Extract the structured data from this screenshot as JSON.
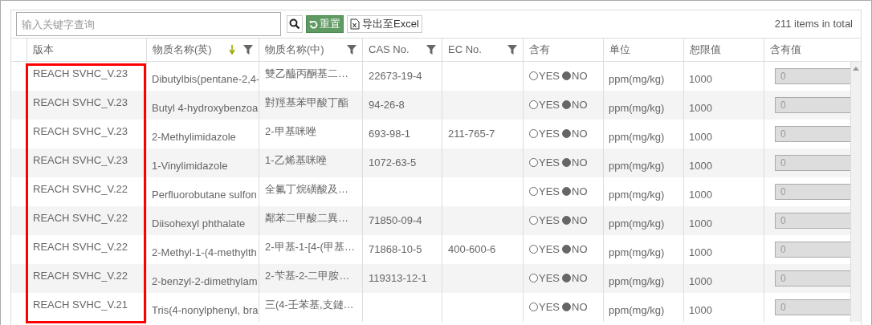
{
  "toolbar": {
    "search": {
      "placeholder": "输入关键字查询"
    },
    "reset_button": "重置",
    "export_button": "导出至Excel",
    "total": "211 items in total"
  },
  "columns": [
    {
      "label": "版本",
      "filter": false,
      "highlighted": true
    },
    {
      "label": "物质名称(英)",
      "filter": true,
      "sorted_descending": true
    },
    {
      "label": "物质名称(中)",
      "filter": true
    },
    {
      "label": "CAS No.",
      "filter": true
    },
    {
      "label": "EC No.",
      "filter": true
    },
    {
      "label": "含有",
      "filter": false
    },
    {
      "label": "单位",
      "filter": false
    },
    {
      "label": "恕限值",
      "filter": false
    },
    {
      "label": "含有值",
      "filter": false
    }
  ],
  "rows": [
    {
      "version": "REACH SVHC_V.23",
      "name_en": "Dibutylbis(pentane-2,4-",
      "name_zh": "雙乙醯丙酮基二…",
      "cas": "22673-19-4",
      "ec": "",
      "options": [
        {
          "label": "YES",
          "selected": false
        },
        {
          "label": "NO",
          "selected": true
        }
      ],
      "unit": "ppm(mg/kg)",
      "threshold": "1000",
      "value": "0"
    },
    {
      "version": "REACH SVHC_V.23",
      "name_en": "Butyl 4-hydroxybenzoa",
      "name_zh": "對羥基苯甲酸丁酯",
      "cas": "94-26-8",
      "ec": "",
      "options": [
        {
          "label": "YES",
          "selected": false
        },
        {
          "label": "NO",
          "selected": true
        }
      ],
      "unit": "ppm(mg/kg)",
      "threshold": "1000",
      "value": "0"
    },
    {
      "version": "REACH SVHC_V.23",
      "name_en": "2-Methylimidazole",
      "name_zh": "2-甲基咪唑",
      "cas": "693-98-1",
      "ec": "211-765-7",
      "options": [
        {
          "label": "YES",
          "selected": false
        },
        {
          "label": "NO",
          "selected": true
        }
      ],
      "unit": "ppm(mg/kg)",
      "threshold": "1000",
      "value": "0"
    },
    {
      "version": "REACH SVHC_V.23",
      "name_en": "1-Vinylimidazole",
      "name_zh": "1-乙烯基咪唑",
      "cas": "1072-63-5",
      "ec": "",
      "options": [
        {
          "label": "YES",
          "selected": false
        },
        {
          "label": "NO",
          "selected": true
        }
      ],
      "unit": "ppm(mg/kg)",
      "threshold": "1000",
      "value": "0"
    },
    {
      "version": "REACH SVHC_V.22",
      "name_en": "Perfluorobutane sulfon",
      "name_zh": "全氟丁烷磺酸及…",
      "cas": "",
      "ec": "",
      "options": [
        {
          "label": "YES",
          "selected": false
        },
        {
          "label": "NO",
          "selected": true
        }
      ],
      "unit": "ppm(mg/kg)",
      "threshold": "1000",
      "value": "0"
    },
    {
      "version": "REACH SVHC_V.22",
      "name_en": "Diisohexyl phthalate",
      "name_zh": "鄰苯二甲酸二異…",
      "cas": "71850-09-4",
      "ec": "",
      "options": [
        {
          "label": "YES",
          "selected": false
        },
        {
          "label": "NO",
          "selected": true
        }
      ],
      "unit": "ppm(mg/kg)",
      "threshold": "1000",
      "value": "0"
    },
    {
      "version": "REACH SVHC_V.22",
      "name_en": "2-Methyl-1-(4-methylth",
      "name_zh": "2-甲基-1-[4-(甲基…",
      "cas": "71868-10-5",
      "ec": "400-600-6",
      "options": [
        {
          "label": "YES",
          "selected": false
        },
        {
          "label": "NO",
          "selected": true
        }
      ],
      "unit": "ppm(mg/kg)",
      "threshold": "1000",
      "value": "0"
    },
    {
      "version": "REACH SVHC_V.22",
      "name_en": "2-benzyl-2-dimethylam",
      "name_zh": "2-苄基-2-二甲胺…",
      "cas": "119313-12-1",
      "ec": "",
      "options": [
        {
          "label": "YES",
          "selected": false
        },
        {
          "label": "NO",
          "selected": true
        }
      ],
      "unit": "ppm(mg/kg)",
      "threshold": "1000",
      "value": "0"
    },
    {
      "version": "REACH SVHC_V.21",
      "name_en": "Tris(4-nonylphenyl, bra",
      "name_zh": "三(4-壬苯基,支鏈…",
      "cas": "",
      "ec": "",
      "options": [
        {
          "label": "YES",
          "selected": false
        },
        {
          "label": "NO",
          "selected": true
        }
      ],
      "unit": "ppm(mg/kg)",
      "threshold": "1000",
      "value": "0"
    }
  ]
}
